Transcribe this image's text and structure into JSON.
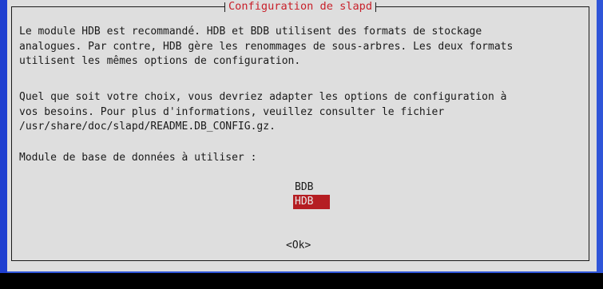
{
  "dialog": {
    "title": "Configuration de slapd",
    "paragraph1": "Le module HDB est recommandé. HDB et BDB utilisent des formats de stockage\nanalogues. Par contre, HDB gère les renommages de sous-arbres. Les deux formats\nutilisent les mêmes options de configuration.",
    "paragraph2": "Quel que soit votre choix, vous devriez adapter les options de configuration à\nvos besoins. Pour plus d'informations, veuillez consulter le fichier\n/usr/share/doc/slapd/README.DB_CONFIG.gz.",
    "prompt": "Module de base de données à utiliser :",
    "options": [
      {
        "label": "BDB",
        "selected": false
      },
      {
        "label": "HDB",
        "selected": true
      }
    ],
    "ok_label": "<Ok>"
  },
  "colors": {
    "background": "#2f55d8",
    "dialog": "#dedede",
    "title": "#c8202a",
    "selection": "#b51d22"
  }
}
